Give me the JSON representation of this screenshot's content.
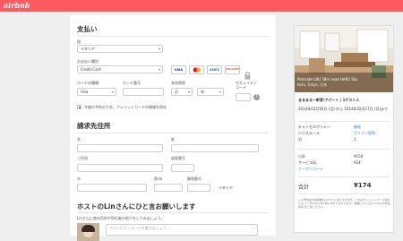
{
  "brand": {
    "logo_text": "airbnb",
    "accent": "#ff5a5f"
  },
  "payment": {
    "title": "支払い",
    "country_label": "国",
    "country_value": "イタリア",
    "method_label": "お支払い種別",
    "method_value": "Credit Card",
    "card_brands": [
      "VISA",
      "MC",
      "AMEX",
      "DISCOVER"
    ],
    "card_type_label": "カードの種類",
    "card_type_value": "Visa",
    "card_number_label": "カード番号",
    "expiry_label": "有効期限",
    "month_value": "月",
    "year_value": "年",
    "security_label": "セキュリティコード",
    "save_card_label": "今後の予約のため、クレジットカードの情報を保存"
  },
  "billing": {
    "title": "請求先住所",
    "last_name_label": "名",
    "first_name_label": "姓",
    "address_label": "ご住所",
    "apt_label": "部屋番号",
    "city_label": "市",
    "state_label": "県/州",
    "zip_label": "郵便番号",
    "country_text": "イタリア"
  },
  "message": {
    "title": "ホストのLinさんにひと言お願いします",
    "subtitle": "Linさんに旅の目的や同行者の紹介をしてみましょう。",
    "placeholder": "ホストにメッセージを書きましょう..."
  },
  "summary": {
    "photo_caption_1": "Parkside LBU 38m near HAKU Sta",
    "photo_caption_2": "Koto, Tokyo, 日本",
    "listing_title": "まるまる一軒家/アパート | 1ゲスト人",
    "dates": "2014年02月16日 (日) から 2014年02月17日 (月)まで",
    "cancel_label": "キャンセルポリシー",
    "cancel_value": "厳格",
    "house_rules_label": "ハウスルール",
    "house_rules_value": "ポリシー説明",
    "nights_label": "泊",
    "nights_value": "1",
    "subtotal_label": "小計",
    "subtotal_value": "¥150",
    "service_label": "サービス料",
    "service_value": "¥24",
    "coupon_label": "クーポンコード",
    "total_label": "合計",
    "total_value": "¥174",
    "footnote": "この予約金の請求額は ¥174 と表示されます。これはクレジットカード会社によって ¥174 (USD 約1.68) となりえます。詳細については Airbnbの支払条件 をご覧ください。"
  }
}
